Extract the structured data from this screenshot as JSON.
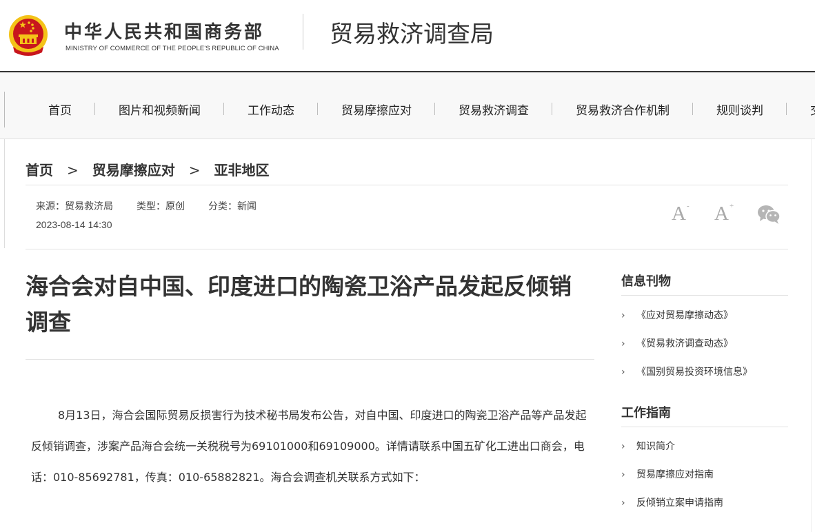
{
  "header": {
    "ministry_cn": "中华人民共和国商务部",
    "ministry_en": "MINISTRY OF COMMERCE OF THE PEOPLE'S REPUBLIC OF CHINA",
    "bureau": "贸易救济调查局"
  },
  "nav": {
    "items": [
      "首页",
      "图片和视频新闻",
      "工作动态",
      "贸易摩擦应对",
      "贸易救济调查",
      "贸易救济合作机制",
      "规则谈判",
      "交"
    ]
  },
  "breadcrumb": {
    "items": [
      "首页",
      "贸易摩擦应对",
      "亚非地区"
    ],
    "separator": ">"
  },
  "meta": {
    "source": "来源：贸易救济局",
    "type": "类型：原创",
    "category": "分类：新闻",
    "date": "2023-08-14 14:30"
  },
  "tools": {
    "font_smaller": "A",
    "font_smaller_sign": "-",
    "font_larger": "A",
    "font_larger_sign": "+"
  },
  "article": {
    "title": "海合会对自中国、印度进口的陶瓷卫浴产品发起反倾销调查",
    "body": "8月13日，海合会国际贸易反损害行为技术秘书局发布公告，对自中国、印度进口的陶瓷卫浴产品等产品发起反倾销调查，涉案产品海合会统一关税税号为69101000和69109000。详情请联系中国五矿化工进出口商会，电话：010-85692781，传真：010-65882821。海合会调查机关联系方式如下："
  },
  "sidebar": {
    "sections": [
      {
        "title": "信息刊物",
        "items": [
          "《应对贸易摩擦动态》",
          "《贸易救济调查动态》",
          "《国别贸易投资环境信息》"
        ]
      },
      {
        "title": "工作指南",
        "items": [
          "知识简介",
          "贸易摩擦应对指南",
          "反倾销立案申请指南"
        ]
      }
    ],
    "arrow": "›"
  },
  "colors": {
    "emblem_red": "#c8161d",
    "emblem_gold": "#f4c318",
    "text": "#333333",
    "muted": "#aaaaaa"
  }
}
